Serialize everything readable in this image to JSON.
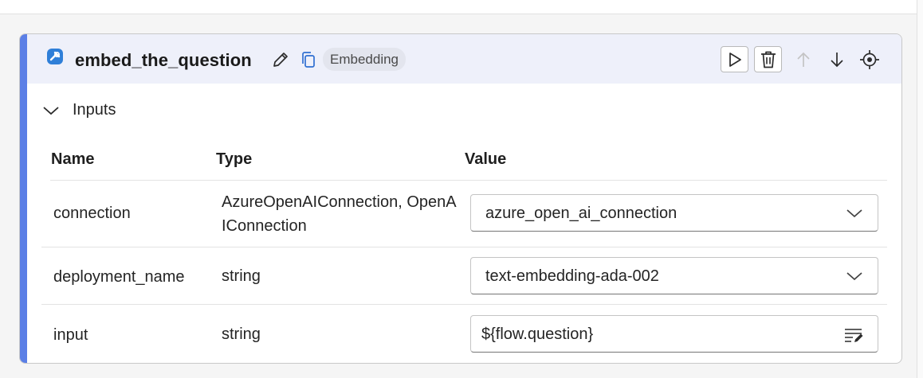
{
  "node": {
    "title": "embed_the_question",
    "badge": "Embedding",
    "icons": {
      "tool": "python-tool-icon",
      "edit": "pencil-icon",
      "copy": "copy-icon"
    }
  },
  "header_actions": [
    {
      "name": "run-button",
      "icon": "play-icon"
    },
    {
      "name": "delete-button",
      "icon": "trash-icon"
    },
    {
      "name": "move-up-button",
      "icon": "arrow-up-icon",
      "disabled": true
    },
    {
      "name": "move-down-button",
      "icon": "arrow-down-icon"
    },
    {
      "name": "locate-button",
      "icon": "target-icon"
    }
  ],
  "inputs": {
    "label": "Inputs",
    "expanded": true,
    "columns": {
      "name": "Name",
      "type": "Type",
      "value": "Value"
    },
    "rows": [
      {
        "name": "connection",
        "type_line1": "AzureOpenAIConnection, OpenA",
        "type_line2": "IConnection",
        "value": "azure_open_ai_connection",
        "control": "dropdown"
      },
      {
        "name": "deployment_name",
        "type_line1": "string",
        "value": "text-embedding-ada-002",
        "control": "dropdown"
      },
      {
        "name": "input",
        "type_line1": "string",
        "value": "${flow.question}",
        "control": "text"
      }
    ]
  },
  "colors": {
    "accent": "#5b7fe6",
    "header_bg": "#eef0fa",
    "badge_bg": "#e3e5ee",
    "tool_icon": "#2f7fd8"
  }
}
